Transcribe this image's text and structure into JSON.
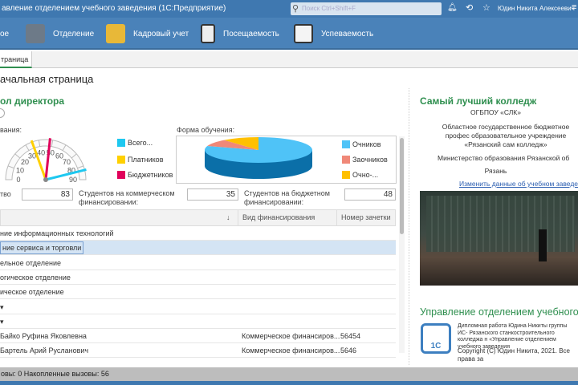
{
  "titlebar": {
    "title": "авление отделением учебного заведения  (1С:Предприятие)",
    "search_placeholder": "Поиск Ctrl+Shift+F",
    "user": "Юдин Никита Алексеевич"
  },
  "nav": [
    {
      "label": "ое",
      "icon": "home-icon"
    },
    {
      "label": "Отделение",
      "icon": "building-icon"
    },
    {
      "label": "Кадровый учет",
      "icon": "people-icon"
    },
    {
      "label": "Посещаемость",
      "icon": "clipboard-icon"
    },
    {
      "label": "Успеваемость",
      "icon": "chart-board-icon"
    }
  ],
  "tab": {
    "label": "траница"
  },
  "page_title": "ачальная страница",
  "left": {
    "section_title": "ол директора",
    "gauge_label": "вания:",
    "gauge": {
      "min": 0,
      "max": 90,
      "ticks": [
        "0",
        "10",
        "20",
        "30",
        "40",
        "50",
        "60",
        "70",
        "80",
        "90"
      ],
      "values": {
        "total": 83,
        "paid": 35,
        "budget": 48
      }
    },
    "gauge_legend": [
      {
        "label": "Всего...",
        "color": "#1ec8f0"
      },
      {
        "label": "Платников",
        "color": "#ffd000"
      },
      {
        "label": "Бюджетников",
        "color": "#e0005a"
      }
    ],
    "pie_label": "Форма обучения:",
    "pie": {
      "type": "pie",
      "slices": [
        {
          "name": "Очников",
          "value": 80,
          "color": "#4fc3f7"
        },
        {
          "name": "Заочников",
          "value": 9,
          "color": "#f08878"
        },
        {
          "name": "Очно-...",
          "value": 11,
          "color": "#ffc000"
        }
      ]
    },
    "fields": {
      "total_label": "тво",
      "total": "83",
      "commercial_label": "Студентов на коммерческом финансировании:",
      "commercial": "35",
      "budget_label": "Студентов на бюджетном финансировании:",
      "budget": "48"
    },
    "table": {
      "columns": [
        "↓",
        "Вид финансирования",
        "Номер зачетки"
      ],
      "rows": [
        {
          "name": "ние информационных технологий",
          "fin": "",
          "num": ""
        },
        {
          "name": "ние сервиса и торговли",
          "fin": "",
          "num": "",
          "selected": true
        },
        {
          "name": "ельное отделение",
          "fin": "",
          "num": ""
        },
        {
          "name": "огическое отделение",
          "fin": "",
          "num": ""
        },
        {
          "name": "ическое отделение",
          "fin": "",
          "num": ""
        },
        {
          "name": "▾",
          "fin": "",
          "num": ""
        },
        {
          "name": "▾",
          "fin": "",
          "num": ""
        },
        {
          "name": "Байко Руфина Яковлевна",
          "fin": "Коммерческое финансиров...",
          "num": "56454"
        },
        {
          "name": "Бартель Арий Русланович",
          "fin": "Коммерческое финансиров...",
          "num": "5646"
        }
      ]
    }
  },
  "right": {
    "title": "Самый лучший колледж",
    "short_name": "ОГБПОУ «СЛК»",
    "full_name": "Областное государственное бюджетное профес образовательное учреждение «Рязанский сам колледж»",
    "ministry": "Министерство образования Рязанской об",
    "city": "Рязань",
    "edit_link": "Изменить данные об учебном заведен",
    "about_title": "Управление отделением учебного з",
    "about_text": "Дипломная работа Юдина Никиты группы ИС- Рязанского станкостроительного колледжа н «Управление отделением учебного заведения",
    "copyright": "Copyright (C) Юдин Никита, 2021. Все права за",
    "logo_text": "1C"
  },
  "status": {
    "text": "овы: 0   Накопленные вызовы: 56"
  }
}
